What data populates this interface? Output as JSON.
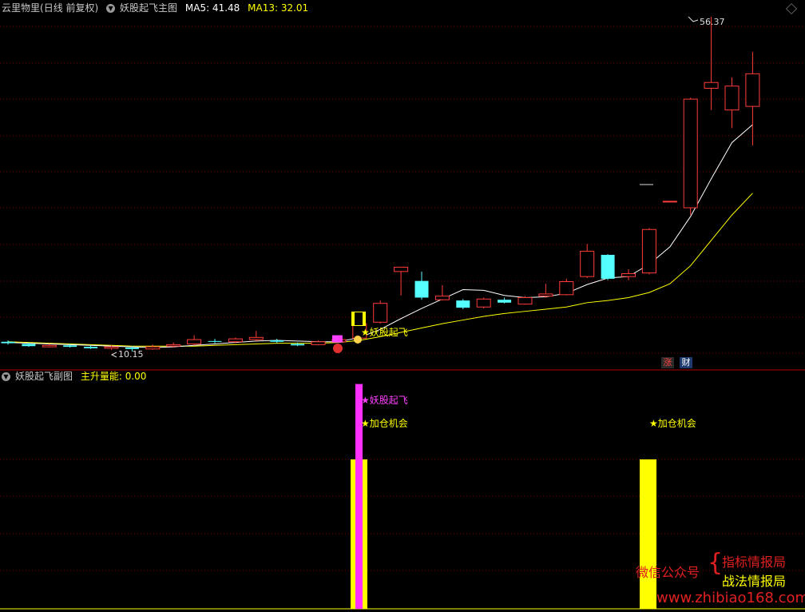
{
  "header": {
    "instrument": "云里物里",
    "period": "(日线 前复权)",
    "indicator": "妖股起飞主图",
    "ma5_label": "MA5: 41.48",
    "ma13_label": "MA13: 32.01",
    "colors": {
      "text": "#c8c8c8",
      "ma5": "#ffffff",
      "ma13": "#ffff00"
    }
  },
  "sub_header": {
    "indicator": "妖股起飞副图",
    "metric": "主升量能: 0.00"
  },
  "annotations": {
    "high_label": "56.37",
    "low_label": "10.15",
    "main_signal": "★妖股起飞",
    "sub_signal": "★妖股起飞",
    "add_chance_1": "★加仓机会",
    "add_chance_2": "★加仓机会"
  },
  "badges": {
    "zhang": "涨",
    "cai": "财"
  },
  "watermark": {
    "account_label": "微信公众号",
    "line1": "指标情报局",
    "line2": "战法情报局",
    "url": "www.zhibiao168.com"
  },
  "chart_data": [
    {
      "type": "candlestick",
      "title": "妖股起飞主图",
      "price_range": [
        10.15,
        56.37
      ],
      "candles": [
        {
          "o": 11.5,
          "c": 11.3,
          "h": 11.7,
          "l": 11.1
        },
        {
          "o": 11.2,
          "c": 10.9,
          "h": 11.4,
          "l": 10.8
        },
        {
          "o": 10.8,
          "c": 11.0,
          "h": 11.2,
          "l": 10.7
        },
        {
          "o": 11.0,
          "c": 10.8,
          "h": 11.2,
          "l": 10.7
        },
        {
          "o": 10.8,
          "c": 10.6,
          "h": 11.0,
          "l": 10.5
        },
        {
          "o": 10.6,
          "c": 10.8,
          "h": 11.0,
          "l": 10.4
        },
        {
          "o": 10.7,
          "c": 10.5,
          "h": 10.9,
          "l": 10.15
        },
        {
          "o": 10.5,
          "c": 10.8,
          "h": 11.1,
          "l": 10.4
        },
        {
          "o": 10.9,
          "c": 11.1,
          "h": 11.4,
          "l": 10.7
        },
        {
          "o": 11.2,
          "c": 11.8,
          "h": 12.4,
          "l": 11.0
        },
        {
          "o": 11.6,
          "c": 11.5,
          "h": 11.9,
          "l": 11.3
        },
        {
          "o": 11.5,
          "c": 11.9,
          "h": 12.1,
          "l": 11.3
        },
        {
          "o": 11.8,
          "c": 12.1,
          "h": 13.0,
          "l": 11.6
        },
        {
          "o": 11.7,
          "c": 11.5,
          "h": 11.9,
          "l": 11.3
        },
        {
          "o": 11.2,
          "c": 11.0,
          "h": 11.4,
          "l": 10.9
        },
        {
          "o": 11.1,
          "c": 11.5,
          "h": 11.7,
          "l": 11.0
        },
        {
          "o": 11.5,
          "c": 11.8,
          "h": 12.0,
          "l": 11.4
        },
        {
          "o": 12.0,
          "c": 14.0,
          "h": 14.4,
          "l": 11.8
        },
        {
          "o": 14.2,
          "c": 16.8,
          "h": 17.2,
          "l": 14.0
        },
        {
          "o": 21.2,
          "c": 21.8,
          "h": 21.8,
          "l": 17.9
        },
        {
          "o": 19.9,
          "c": 17.6,
          "h": 21.2,
          "l": 17.3
        },
        {
          "o": 17.3,
          "c": 17.8,
          "h": 19.3,
          "l": 17.2
        },
        {
          "o": 17.2,
          "c": 16.2,
          "h": 17.4,
          "l": 16.0
        },
        {
          "o": 16.3,
          "c": 17.4,
          "h": 17.6,
          "l": 16.1
        },
        {
          "o": 17.3,
          "c": 16.9,
          "h": 17.6,
          "l": 16.8
        },
        {
          "o": 16.7,
          "c": 17.6,
          "h": 17.8,
          "l": 16.6
        },
        {
          "o": 17.8,
          "c": 18.1,
          "h": 19.5,
          "l": 17.6
        },
        {
          "o": 18.0,
          "c": 19.8,
          "h": 20.2,
          "l": 17.9
        },
        {
          "o": 20.5,
          "c": 24.0,
          "h": 25.0,
          "l": 20.3
        },
        {
          "o": 23.5,
          "c": 20.2,
          "h": 23.6,
          "l": 20.0
        },
        {
          "o": 20.5,
          "c": 20.9,
          "h": 21.5,
          "l": 20.0
        },
        {
          "o": 21.0,
          "c": 27.0,
          "h": 27.2,
          "l": 20.8
        },
        {
          "o": 30.9,
          "c": 30.9,
          "h": 30.9,
          "l": 30.9
        },
        {
          "o": 30.0,
          "c": 45.0,
          "h": 45.2,
          "l": 29.0
        },
        {
          "o": 46.5,
          "c": 47.3,
          "h": 56.37,
          "l": 43.5
        },
        {
          "o": 43.5,
          "c": 46.8,
          "h": 48.0,
          "l": 41.0
        },
        {
          "o": 44.0,
          "c": 48.5,
          "h": 51.5,
          "l": 38.6
        }
      ],
      "ma5": [
        11.4,
        11.3,
        11.2,
        11.1,
        11.0,
        10.9,
        10.8,
        10.7,
        10.8,
        11.0,
        11.2,
        11.4,
        11.6,
        11.7,
        11.6,
        11.5,
        11.5,
        12.1,
        13.2,
        14.7,
        16.1,
        17.4,
        18.7,
        18.6,
        17.9,
        17.6,
        17.7,
        18.2,
        19.4,
        20.3,
        20.5,
        22.2,
        24.6,
        28.8,
        34.0,
        39.0,
        41.48
      ],
      "ma13": [
        11.5,
        11.4,
        11.3,
        11.2,
        11.1,
        11.0,
        10.9,
        10.9,
        10.9,
        10.9,
        11.0,
        11.1,
        11.2,
        11.3,
        11.3,
        11.3,
        11.4,
        11.7,
        12.2,
        12.8,
        13.4,
        14.0,
        14.5,
        15.0,
        15.4,
        15.7,
        16.0,
        16.3,
        16.9,
        17.2,
        17.6,
        18.3,
        19.5,
        22.0,
        25.5,
        29.0,
        32.01
      ]
    },
    {
      "type": "bar",
      "title": "妖股起飞副图",
      "series": [
        {
          "name": "主升量能",
          "values": [
            0,
            0,
            0,
            0,
            0,
            0,
            0,
            0,
            0,
            0,
            0,
            0,
            0,
            0,
            0,
            0,
            0,
            1.0,
            0,
            0,
            0,
            0,
            0,
            0,
            0,
            0,
            0,
            0,
            0,
            0,
            0,
            0,
            0,
            1.0,
            0,
            0,
            0
          ]
        }
      ],
      "signal_bar_index": 17,
      "signal_bar_value": 1.5
    }
  ]
}
